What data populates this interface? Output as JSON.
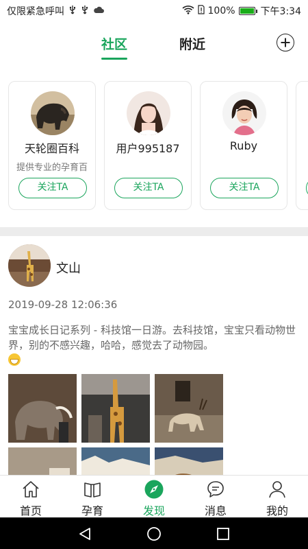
{
  "status_bar": {
    "left_text": "仅限紧急呼叫",
    "battery": "100%",
    "time": "下午3:34"
  },
  "top_tabs": {
    "community": "社区",
    "nearby": "附近"
  },
  "user_cards": [
    {
      "name": "天轮圈百科",
      "desc": "提供专业的孕育百",
      "follow": "关注TA"
    },
    {
      "name": "用户995187",
      "desc": "",
      "follow": "关注TA"
    },
    {
      "name": "Ruby",
      "desc": "",
      "follow": "关注TA"
    }
  ],
  "post": {
    "author": "文山",
    "time": "2019-09-28 12:06:36",
    "text": "宝宝成长日记系列 - 科技馆一日游。去科技馆，宝宝只看动物世界，别的不感兴趣，哈哈，感觉去了动物园。"
  },
  "bottom_nav": {
    "home": "首页",
    "parenting": "孕育",
    "discover": "发现",
    "messages": "消息",
    "mine": "我的"
  },
  "colors": {
    "accent": "#1aa55c",
    "divider": "#ececec"
  }
}
